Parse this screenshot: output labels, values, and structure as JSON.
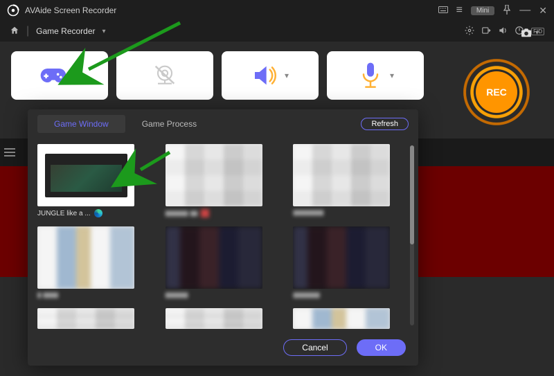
{
  "app": {
    "title": "AVAide Screen Recorder"
  },
  "titlebar": {
    "mini": "Mini"
  },
  "toolbar": {
    "mode": "Game Recorder",
    "fid_label": "FID"
  },
  "cards": {
    "game": {
      "name": "game-recorder"
    },
    "webcam": {
      "name": "webcam"
    },
    "speaker": {
      "name": "system-sound"
    },
    "mic": {
      "name": "microphone"
    }
  },
  "rec": {
    "label": "REC"
  },
  "popup": {
    "tabs": {
      "window": "Game Window",
      "process": "Game Process"
    },
    "refresh": "Refresh",
    "items": [
      {
        "label": "JUNGLE like a ...",
        "browser": "edge"
      }
    ],
    "buttons": {
      "cancel": "Cancel",
      "ok": "OK"
    }
  }
}
